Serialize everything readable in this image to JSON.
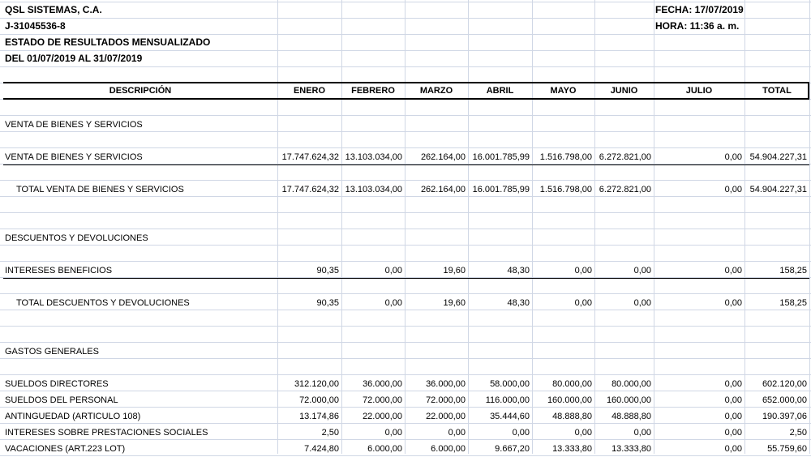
{
  "company": {
    "name": "QSL SISTEMAS, C.A.",
    "rif": "J-31045536-8",
    "report_title": "ESTADO DE RESULTADOS MENSUALIZADO",
    "period": "DEL  01/07/2019  AL  31/07/2019",
    "fecha": "FECHA: 17/07/2019",
    "hora": "HORA: 11:36 a. m."
  },
  "columns": [
    "DESCRIPCIÓN",
    "ENERO",
    "FEBRERO",
    "MARZO",
    "ABRIL",
    "MAYO",
    "JUNIO",
    "JULIO",
    "TOTAL"
  ],
  "rows": [
    {
      "label": "VENTA DE BIENES Y SERVICIOS"
    },
    {
      "label": "VENTA DE BIENES Y SERVICIOS",
      "values": [
        "17.747.624,32",
        "13.103.034,00",
        "262.164,00",
        "16.001.785,99",
        "1.516.798,00",
        "6.272.821,00",
        "0,00",
        "54.904.227,31"
      ]
    },
    {
      "label": "TOTAL VENTA DE BIENES Y SERVICIOS",
      "indent": true,
      "values": [
        "17.747.624,32",
        "13.103.034,00",
        "262.164,00",
        "16.001.785,99",
        "1.516.798,00",
        "6.272.821,00",
        "0,00",
        "54.904.227,31"
      ]
    },
    {
      "label": "DESCUENTOS Y DEVOLUCIONES"
    },
    {
      "label": "INTERESES BENEFICIOS",
      "values": [
        "90,35",
        "0,00",
        "19,60",
        "48,30",
        "0,00",
        "0,00",
        "0,00",
        "158,25"
      ]
    },
    {
      "label": "TOTAL DESCUENTOS Y DEVOLUCIONES",
      "indent": true,
      "values": [
        "90,35",
        "0,00",
        "19,60",
        "48,30",
        "0,00",
        "0,00",
        "0,00",
        "158,25"
      ]
    },
    {
      "label": "GASTOS GENERALES"
    },
    {
      "label": "SUELDOS DIRECTORES",
      "values": [
        "312.120,00",
        "36.000,00",
        "36.000,00",
        "58.000,00",
        "80.000,00",
        "80.000,00",
        "0,00",
        "602.120,00"
      ]
    },
    {
      "label": "SUELDOS DEL PERSONAL",
      "values": [
        "72.000,00",
        "72.000,00",
        "72.000,00",
        "116.000,00",
        "160.000,00",
        "160.000,00",
        "0,00",
        "652.000,00"
      ]
    },
    {
      "label": "ANTINGUEDAD (ARTICULO 108)",
      "values": [
        "13.174,86",
        "22.000,00",
        "22.000,00",
        "35.444,60",
        "48.888,80",
        "48.888,80",
        "0,00",
        "190.397,06"
      ]
    },
    {
      "label": "INTERESES SOBRE PRESTACIONES SOCIALES",
      "values": [
        "2,50",
        "0,00",
        "0,00",
        "0,00",
        "0,00",
        "0,00",
        "0,00",
        "2,50"
      ]
    },
    {
      "label": "VACACIONES (ART.223 LOT)",
      "values": [
        "7.424,80",
        "6.000,00",
        "6.000,00",
        "9.667,20",
        "13.333,80",
        "13.333,80",
        "0,00",
        "55.759,60"
      ]
    }
  ]
}
